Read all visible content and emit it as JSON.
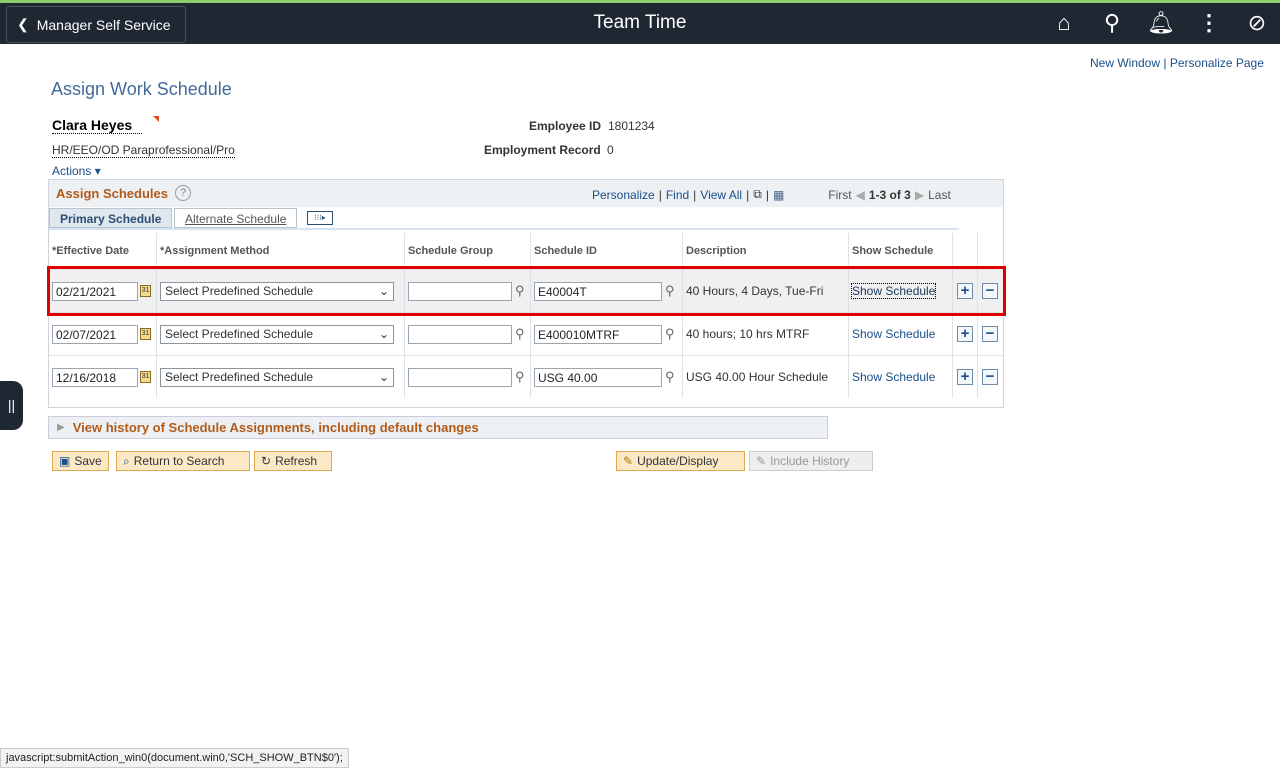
{
  "header": {
    "back_label": "Manager Self Service",
    "title": "Team Time",
    "icons": [
      "home-icon",
      "search-icon",
      "bell-icon",
      "more-vertical-icon",
      "compass-icon"
    ]
  },
  "links": {
    "new_window": "New Window",
    "personalize_page": "Personalize Page"
  },
  "page_title": "Assign Work Schedule",
  "employee": {
    "name": "Clara Heyes",
    "job": "HR/EEO/OD Paraprofessional/Pro",
    "id_label": "Employee ID",
    "id": "1801234",
    "record_label": "Employment Record",
    "record": "0",
    "actions": "Actions"
  },
  "grid": {
    "title": "Assign Schedules",
    "personalize": "Personalize",
    "find": "Find",
    "view_all": "View All",
    "first": "First",
    "range": "1-3 of 3",
    "last": "Last",
    "tabs": [
      "Primary Schedule",
      "Alternate Schedule"
    ],
    "columns": [
      "*Effective Date",
      "*Assignment Method",
      "Schedule Group",
      "Schedule ID",
      "Description",
      "Show Schedule"
    ],
    "rows": [
      {
        "date": "02/21/2021",
        "method": "Select Predefined Schedule",
        "group": "",
        "schedule_id": "E40004T",
        "description": "40 Hours, 4 Days, Tue-Fri",
        "show": "Show Schedule"
      },
      {
        "date": "02/07/2021",
        "method": "Select Predefined Schedule",
        "group": "",
        "schedule_id": "E400010MTRF",
        "description": "40 hours; 10 hrs MTRF",
        "show": "Show Schedule"
      },
      {
        "date": "12/16/2018",
        "method": "Select Predefined Schedule",
        "group": "",
        "schedule_id": "USG 40.00",
        "description": "USG 40.00 Hour Schedule",
        "show": "Show Schedule"
      }
    ]
  },
  "history_label": "View history of Schedule Assignments, including default changes",
  "buttons": {
    "save": "Save",
    "return": "Return to Search",
    "refresh": "Refresh",
    "update": "Update/Display",
    "include_history": "Include History"
  },
  "status_bar": "javascript:submitAction_win0(document.win0,'SCH_SHOW_BTN$0');",
  "colors": {
    "header_bg": "#1f2733",
    "highlight_border": "#e00000",
    "section_title": "#b15b1b"
  }
}
